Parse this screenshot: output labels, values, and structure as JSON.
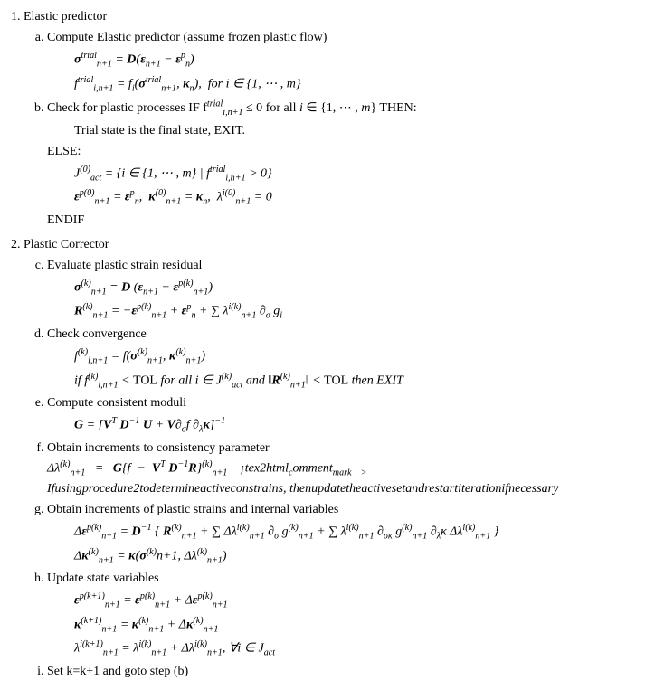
{
  "sections": {
    "s1": {
      "title": "Elastic predictor"
    },
    "s2": {
      "title": "Plastic Corrector"
    }
  },
  "steps": {
    "a": {
      "label": "Compute Elastic predictor (assume frozen plastic flow)",
      "eq1_html": "<span class='bf'>σ</span><span class='sup'>trial</span><span class='sub'>n+1</span> = <span class='bf rm'>D</span>(<span class='bf'>ε</span><span class='sub'>n+1</span> − <span class='bf'>ε</span><span class='sup'>p</span><span class='sub'>n</span>)",
      "eq2_html": "f<span class='sup'>trial</span><span class='sub'>i,n+1</span> = f<span class='sub'>i</span>(<span class='bf'>σ</span><span class='sup'>trial</span><span class='sub'>n+1</span>, <span class='bf'>κ</span><span class='sub'>n</span>),&nbsp;&nbsp;for i ∈ {1, ⋯ , m}"
    },
    "b": {
      "label_html": "Check for plastic processes IF f<span class='sup'>trial</span><span class='sub'>i,n+1</span> ≤ 0 for all <span class='math'>i</span> ∈ {1, ⋯ , <span class='math'>m</span>} THEN:",
      "trial_line": "Trial state is the final state, EXIT.",
      "else_kw": "ELSE:",
      "eq1_html": "J<span class='sup'>(0)</span><span class='sub'>act</span> = {i ∈ {1, ⋯ , m} | f<span class='sup'>trial</span><span class='sub'>i,n+1</span> > 0}",
      "eq2_html": "<span class='bf'>ε</span><span class='sup'>p(0)</span><span class='sub'>n+1</span> = <span class='bf'>ε</span><span class='sup'>p</span><span class='sub'>n</span>,&nbsp; <span class='bf'>κ</span><span class='sup'>(0)</span><span class='sub'>n+1</span> = <span class='bf'>κ</span><span class='sub'>n</span>,&nbsp; λ<span class='sup'>i(0)</span><span class='sub'>n+1</span> = 0",
      "endif_kw": "ENDIF"
    },
    "c": {
      "label": "Evaluate plastic strain residual",
      "eq1_html": "<span class='bf'>σ</span><span class='sup'>(k)</span><span class='sub'>n+1</span> = <span class='bf rm'>D</span> (<span class='bf'>ε</span><span class='sub'>n+1</span> − <span class='bf'>ε</span><span class='sup'>p(k)</span><span class='sub'>n+1</span>)",
      "eq2_html": "<span class='bf'>R</span><span class='sup'>(k)</span><span class='sub'>n+1</span> = −<span class='bf'>ε</span><span class='sup'>p(k)</span><span class='sub'>n+1</span> + <span class='bf'>ε</span><span class='sup'>p</span><span class='sub'>n</span> + ∑ λ<span class='sup'>i(k)</span><span class='sub'>n+1</span> ∂<span class='sub'>σ</span> g<span class='sub'>i</span>"
    },
    "d": {
      "label": "Check convergence",
      "eq1_html": "f<span class='sup'>(k)</span><span class='sub'>i,n+1</span> = f(<span class='bf'>σ</span><span class='sup'>(k)</span><span class='sub'>n+1</span>, <span class='bf'>κ</span><span class='sup'>(k)</span><span class='sub'>n+1</span>)",
      "eq2_html": "if f<span class='sup'>(k)</span><span class='sub'>i,n+1</span> &lt; <span class='rm'>TOL</span> for all <span class='math'>i</span> ∈ J<span class='sup'>(k)</span><span class='sub'>act</span> and ‖<span class='bf'>R</span><span class='sup'>(k)</span><span class='sub'>n+1</span>‖ &lt; <span class='rm'>TOL</span> then EXIT"
    },
    "e": {
      "label": "Compute consistent moduli",
      "eq1_html": "<span class='bf rm'>G</span> = [<span class='bf rm'>V</span><span class='sup'>T</span> <span class='bf rm'>D</span><span class='sup'>−1</span> <span class='bf rm'>U</span> + <span class='bf rm'>V</span>∂<span class='sub'>σ</span>f ∂<span class='sub'>λ</span><span class='bf'>κ</span>]<span class='sup'>−1</span>"
    },
    "f": {
      "label": "Obtain increments to consistency parameter",
      "eq1_html": "Δλ<span class='sup'>(k)</span><span class='sub'>n+1</span>&nbsp;&nbsp;&nbsp;=&nbsp;&nbsp;&nbsp;<span class='bf rm'>G</span>{f&nbsp;&nbsp;−&nbsp;&nbsp;<span class='bf rm'>V</span><span class='sup'>T</span> <span class='bf rm'>D</span><span class='sup'>−1</span><span class='bf'>R</span>}<span class='sup'>(k)</span><span class='sub'>n+1</span>&nbsp;&nbsp;&nbsp;&nbsp;¡tex2html<span class='sub'>c</span>omment<span class='sub'>m</sub>ark&nbsp;&nbsp;&nbsp;&nbsp;>",
      "eq2": "Ifusingprocedure2todetermineactiveconstrains, thenupdatetheactivesetandrestartiterationifnecessary"
    },
    "g": {
      "label": "Obtain increments of plastic strains and internal variables",
      "eq1_html": "Δ<span class='bf'>ε</span><span class='sup'>p(k)</span><span class='sub'>n+1</span> = <span class='bf rm'>D</span><span class='sup'>−1</span> { <span class='bf'>R</span><span class='sup'>(k)</span><span class='sub'>n+1</span> + ∑ Δλ<span class='sup'>i(k)</span><span class='sub'>n+1</span> ∂<span class='sub'>σ</span> g<span class='sup'>(k)</span><span class='sub'>n+1</span> + ∑ λ<span class='sup'>i(k)</span><span class='sub'>n+1</span> ∂<span class='sub'>σκ</span> g<span class='sup'>(k)</span><span class='sub'>n+1</span> ∂<span class='sub'>λ</span>κ Δλ<span class='sup'>i(k)</span><span class='sub'>n+1</span> }",
      "eq2_html": "Δ<span class='bf'>κ</span><span class='sup'>(k)</span><span class='sub'>n+1</span> = <span class='bf'>κ</span>(<span class='bf'>σ</span><span class='sup'>(k)</span>n+1, Δλ<span class='sup'>(k)</span><span class='sub'>n+1</span>)"
    },
    "h": {
      "label": "Update state variables",
      "eq1_html": "<span class='bf'>ε</span><span class='sup'>p(k+1)</span><span class='sub'>n+1</span> = <span class='bf'>ε</span><span class='sup'>p(k)</span><span class='sub'>n+1</span> + Δ<span class='bf'>ε</span><span class='sup'>p(k)</span><span class='sub'>n+1</span>",
      "eq2_html": "<span class='bf'>κ</span><span class='sup'>(k+1)</span><span class='sub'>n+1</span> = <span class='bf'>κ</span><span class='sup'>(k)</span><span class='sub'>n+1</span> + Δ<span class='bf'>κ</span><span class='sup'>(k)</span><span class='sub'>n+1</span>",
      "eq3_html": "λ<span class='sup'>i(k+1)</span><span class='sub'>n+1</span> = λ<span class='sup'>i(k)</span><span class='sub'>n+1</span> + Δλ<span class='sup'>i(k)</span><span class='sub'>n+1</span>, ∀i ∈ J<span class='sub'>act</span>"
    },
    "i": {
      "label": "Set k=k+1 and goto step (b)"
    }
  }
}
